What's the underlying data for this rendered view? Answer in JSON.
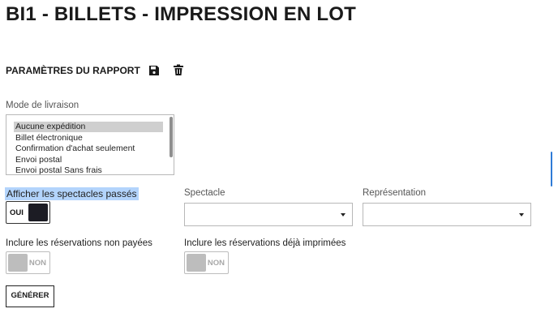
{
  "page": {
    "title": "BI1 - BILLETS - IMPRESSION EN LOT"
  },
  "report_params": {
    "title": "PARAMÈTRES DU RAPPORT",
    "save_icon": "floppy-disk-icon",
    "delete_icon": "trash-icon"
  },
  "delivery": {
    "label": "Mode de livraison",
    "options": [
      {
        "label": "Aucune expédition",
        "selected": true
      },
      {
        "label": "Billet électronique",
        "selected": false
      },
      {
        "label": "Confirmation d'achat seulement",
        "selected": false
      },
      {
        "label": "Envoi postal",
        "selected": false
      },
      {
        "label": "Envoi postal Sans frais",
        "selected": false
      }
    ]
  },
  "past_shows": {
    "label": "Afficher les spectacles passés",
    "state_label": "OUI",
    "on": true
  },
  "spectacle": {
    "label": "Spectacle",
    "value": ""
  },
  "representation": {
    "label": "Représentation",
    "value": ""
  },
  "unpaid": {
    "label": "Inclure les réservations non payées",
    "state_label": "NON",
    "on": false
  },
  "already_printed": {
    "label": "Inclure les réservations déjà imprimées",
    "state_label": "NON",
    "on": false
  },
  "generate": {
    "label": "GÉNÉRER"
  },
  "colors": {
    "highlight": "#b3d4fc",
    "toggle_on": "#1c1c24",
    "toggle_off": "#bdbdbd",
    "scroll_accent": "#2f7bd6"
  }
}
